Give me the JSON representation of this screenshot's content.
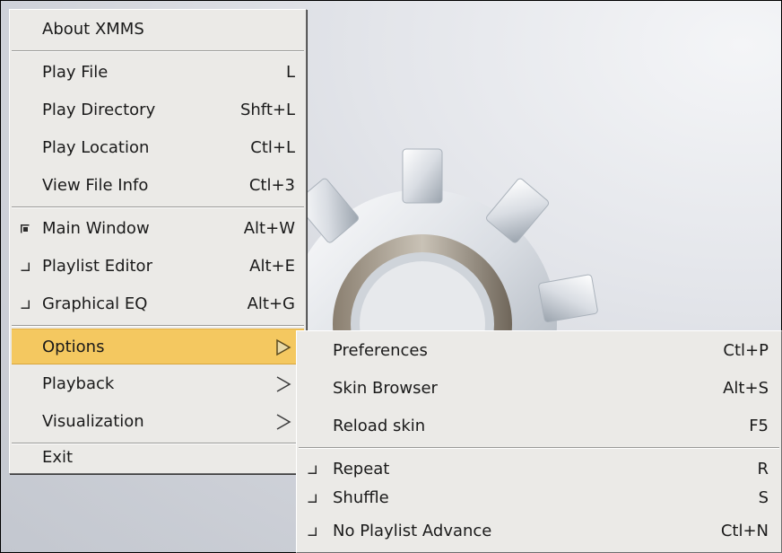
{
  "main_menu": {
    "items": [
      {
        "label": "About XMMS"
      },
      {
        "label": "Play File",
        "accel": "L"
      },
      {
        "label": "Play Directory",
        "accel": "Shft+L"
      },
      {
        "label": "Play Location",
        "accel": "Ctl+L"
      },
      {
        "label": "View File Info",
        "accel": "Ctl+3"
      },
      {
        "label": "Main Window",
        "accel": "Alt+W",
        "checked": true
      },
      {
        "label": "Playlist Editor",
        "accel": "Alt+E",
        "checked": false
      },
      {
        "label": "Graphical EQ",
        "accel": "Alt+G",
        "checked": false
      },
      {
        "label": "Options",
        "highlighted": true
      },
      {
        "label": "Playback"
      },
      {
        "label": "Visualization"
      },
      {
        "label": "Exit"
      }
    ]
  },
  "options_menu": {
    "items": [
      {
        "label": "Preferences",
        "accel": "Ctl+P"
      },
      {
        "label": "Skin Browser",
        "accel": "Alt+S"
      },
      {
        "label": "Reload skin",
        "accel": "F5"
      },
      {
        "label": "Repeat",
        "accel": "R",
        "checked": false
      },
      {
        "label": "Shuffle",
        "accel": "S",
        "checked": false
      },
      {
        "label": "No Playlist Advance",
        "accel": "Ctl+N",
        "checked": false
      }
    ]
  },
  "colors": {
    "menu_bg": "#ebeae7",
    "highlight": "#f4c860"
  }
}
